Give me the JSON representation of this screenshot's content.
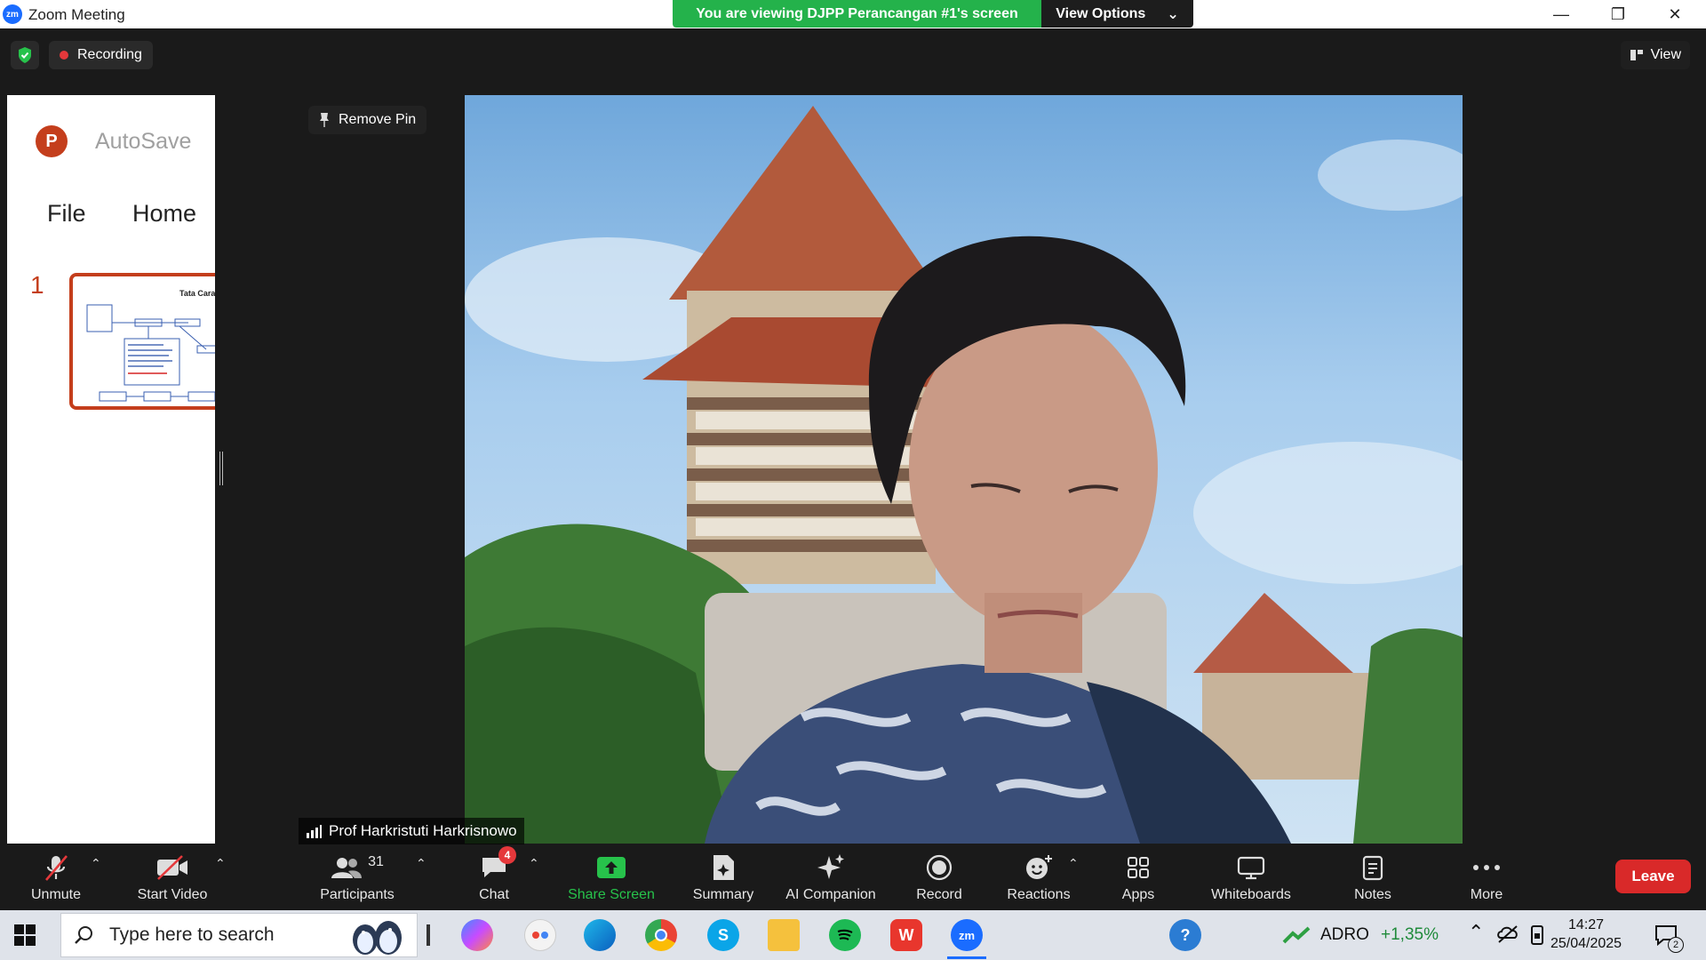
{
  "window": {
    "title": "Zoom Meeting",
    "logo": "zm"
  },
  "banner": {
    "message": "You are viewing DJPP Perancangan #1's screen",
    "options_label": "View Options"
  },
  "topbar": {
    "recording_label": "Recording",
    "view_label": "View"
  },
  "ppt": {
    "logo": "P",
    "autosave": "AutoSave",
    "menu": {
      "file": "File",
      "home": "Home"
    },
    "slide_number": "1",
    "slide_title": "Tata Cara"
  },
  "pin": {
    "label": "Remove Pin"
  },
  "participant": {
    "name": "Prof Harkristuti Harkrisnowo"
  },
  "toolbar": {
    "unmute": "Unmute",
    "start_video": "Start Video",
    "participants": "Participants",
    "participants_count": "31",
    "chat": "Chat",
    "chat_badge": "4",
    "share_screen": "Share Screen",
    "summary": "Summary",
    "ai_companion": "AI Companion",
    "record": "Record",
    "reactions": "Reactions",
    "apps": "Apps",
    "whiteboards": "Whiteboards",
    "notes": "Notes",
    "more": "More",
    "leave": "Leave"
  },
  "taskbar": {
    "search_placeholder": "Type here to search",
    "stock_symbol": "ADRO",
    "stock_change": "+1,35%",
    "time": "14:27",
    "date": "25/04/2025",
    "notification_count": "2",
    "zoom_logo": "zm"
  },
  "colors": {
    "share_green": "#24b24b",
    "leave_red": "#d92929",
    "ppt_orange": "#c43e1c",
    "zoom_blue": "#1a6cff"
  }
}
